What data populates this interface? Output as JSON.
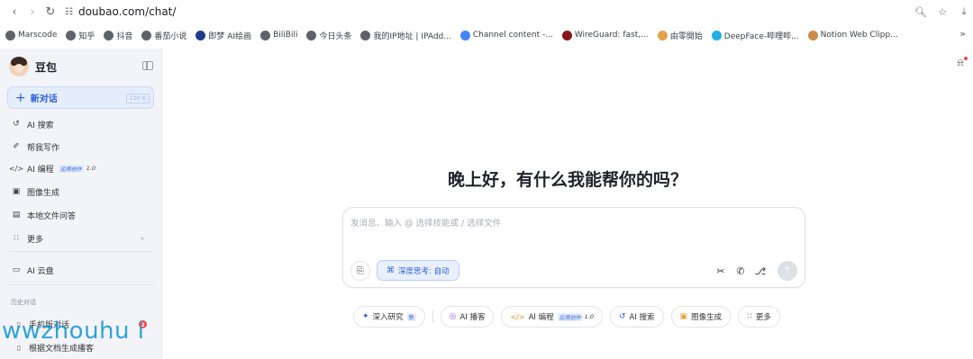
{
  "browser": {
    "url": "doubao.com/chat/",
    "bookmarks": [
      {
        "label": "Marscode",
        "icon": "globe-icon",
        "color": "#5f6368"
      },
      {
        "label": "知乎",
        "icon": "globe-icon",
        "color": "#5f6368"
      },
      {
        "label": "抖音",
        "icon": "globe-icon",
        "color": "#5f6368"
      },
      {
        "label": "番茄小说",
        "icon": "globe-icon",
        "color": "#5f6368"
      },
      {
        "label": "即梦 AI绘画",
        "icon": "jimeng-icon",
        "color": "#1c3c8c"
      },
      {
        "label": "BiliBili",
        "icon": "globe-icon",
        "color": "#5f6368"
      },
      {
        "label": "今日头条",
        "icon": "globe-icon",
        "color": "#5f6368"
      },
      {
        "label": "我的IP地址 | IPAdd...",
        "icon": "globe-icon",
        "color": "#5f6368"
      },
      {
        "label": "Channel content -...",
        "icon": "google-icon",
        "color": "#4285f4"
      },
      {
        "label": "WireGuard: fast,...",
        "icon": "wireguard-icon",
        "color": "#88171a"
      },
      {
        "label": "由零開始",
        "icon": "sprout-icon",
        "color": "#e3a34a"
      },
      {
        "label": "DeepFace-哔哩哔...",
        "icon": "bilibili-icon",
        "color": "#23ade5"
      },
      {
        "label": "Notion Web Clipp...",
        "icon": "notion-icon",
        "color": "#c98a4b"
      }
    ]
  },
  "sidebar": {
    "app_name": "豆包",
    "new_chat_label": "新对话",
    "new_chat_shortcut": "Ctrl K",
    "items": [
      {
        "label": "AI 搜索",
        "icon": "search-refresh-icon"
      },
      {
        "label": "帮我写作",
        "icon": "pen-icon"
      },
      {
        "label": "AI 编程",
        "icon": "code-icon",
        "tag": "应用创作",
        "version": "1.0"
      },
      {
        "label": "图像生成",
        "icon": "image-icon"
      },
      {
        "label": "本地文件问答",
        "icon": "file-icon"
      },
      {
        "label": "更多",
        "icon": "grid-icon"
      }
    ],
    "cloud_label": "AI 云盘",
    "history_section": "历史对话",
    "history": [
      {
        "label": "手机版对话",
        "icon": "phone-icon",
        "badge": "2"
      },
      {
        "label": "根据文档生成播客",
        "icon": "doc-icon"
      }
    ]
  },
  "main": {
    "greeting": "晚上好，有什么我能帮你的吗？",
    "input_placeholder": "发消息、输入 @ 选择技能或 / 选择文件",
    "deep_think_label": "深度思考: 自动",
    "chips": [
      {
        "label": "深入研究",
        "icon": "telescope-icon",
        "mini": "新",
        "color": "#2a5fd8"
      },
      {
        "label": "AI 播客",
        "icon": "podcast-icon",
        "color": "#8b5cf6"
      },
      {
        "label": "AI 编程",
        "icon": "code-icon",
        "tag": "应用创作",
        "version": "1.0",
        "color": "#e58b2a"
      },
      {
        "label": "AI 搜索",
        "icon": "search-refresh-icon",
        "color": "#2a5fd8"
      },
      {
        "label": "图像生成",
        "icon": "image-icon",
        "color": "#e9a23b"
      },
      {
        "label": "更多",
        "icon": "grid-icon",
        "color": "#666"
      }
    ]
  },
  "watermark": "wwzhouhu i",
  "accent_color": "#2a5fd8"
}
